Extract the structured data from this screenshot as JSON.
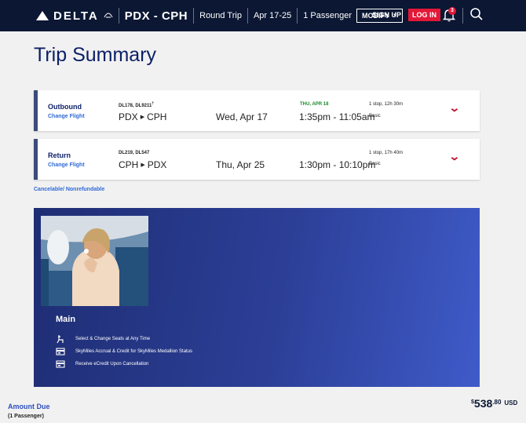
{
  "header": {
    "brand": "DELTA",
    "route": "PDX - CPH",
    "trip_type": "Round Trip",
    "dates": "Apr 17-25",
    "passengers": "1 Passenger",
    "modify_label": "MODIFY",
    "sign_up_label": "SIGN UP",
    "log_in_label": "LOG IN",
    "notification_count": "3",
    "icons": [
      "delta-widget-icon",
      "bell-icon",
      "search-icon",
      "chevron-down-icon"
    ]
  },
  "page": {
    "title": "Trip Summary",
    "fare_policy": "Cancelable/ Nonrefundable"
  },
  "flights": [
    {
      "direction": "Outbound",
      "change_label": "Change Flight",
      "flight_numbers": "DL178, DL9211",
      "flight_number_mark": "†",
      "origin": "PDX",
      "destination": "CPH",
      "date": "Wed, Apr 17",
      "arrival_note": "THU, APR 18",
      "times": "1:35pm - 11:05am",
      "stops_duration": "1 stop, 12h 30m",
      "fare_class": "Basic"
    },
    {
      "direction": "Return",
      "change_label": "Change Flight",
      "flight_numbers": "DL219, DL547",
      "origin": "CPH",
      "destination": "PDX",
      "date": "Thu, Apr 25",
      "times": "1:30pm - 10:10pm",
      "stops_duration": "1 stop, 17h 40m",
      "fare_class": "Basic"
    }
  ],
  "promo": {
    "title": "Main",
    "perks": [
      {
        "icon": "seat-select-icon",
        "text": "Select & Change Seats at Any Time"
      },
      {
        "icon": "skymiles-card-icon",
        "text": "SkyMiles Accrual & Credit for SkyMiles Medallion Status"
      },
      {
        "icon": "ecredit-card-icon",
        "text": "Receive eCredit Upon Cancellation"
      }
    ]
  },
  "amount_due": {
    "label": "Amount Due",
    "passengers": "(1 Passenger)",
    "currency_symbol": "$",
    "amount_whole": "538",
    "amount_cents": ".80",
    "currency_code": "USD"
  },
  "colors": {
    "header_bg": "#0b1733",
    "login_red": "#e31837",
    "title_navy": "#0b1f66",
    "link_blue": "#2f6ad6",
    "arrival_green": "#1a8a2a",
    "chevron_red": "#c01933"
  }
}
